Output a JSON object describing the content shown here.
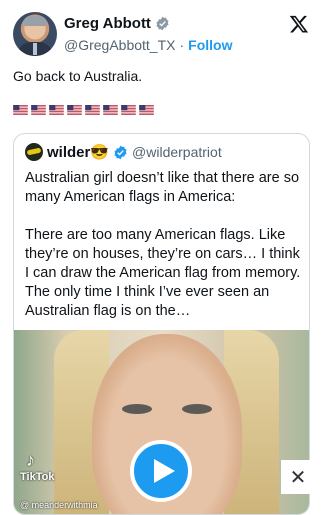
{
  "author": {
    "name": "Greg Abbott",
    "handle": "@GregAbbott_TX",
    "separator": "·",
    "follow_label": "Follow"
  },
  "tweet": {
    "text": "Go back to Australia.",
    "flag_count": 8
  },
  "quote": {
    "name": "wilder😎",
    "handle": "@wilderpatriot",
    "paragraphs": [
      "Australian girl doesn’t like that there are so many American flags in America:",
      "There are too many American flags. Like they’re on houses, they’re on cars… I think I can draw the American flag from memory. The only time I think I’ve ever seen an Australian flag is on the…"
    ],
    "video": {
      "watermark": "TikTok",
      "tiktok_user": "@ meanderwithmia"
    }
  },
  "close_label": "✕",
  "colors": {
    "accent": "#1d9bf0",
    "text": "#0f1419",
    "muted": "#536471",
    "border": "#cfd9de"
  },
  "icons": [
    "verified-badge-icon",
    "x-logo-icon",
    "us-flag-icon",
    "play-icon",
    "tiktok-icon",
    "close-icon"
  ]
}
